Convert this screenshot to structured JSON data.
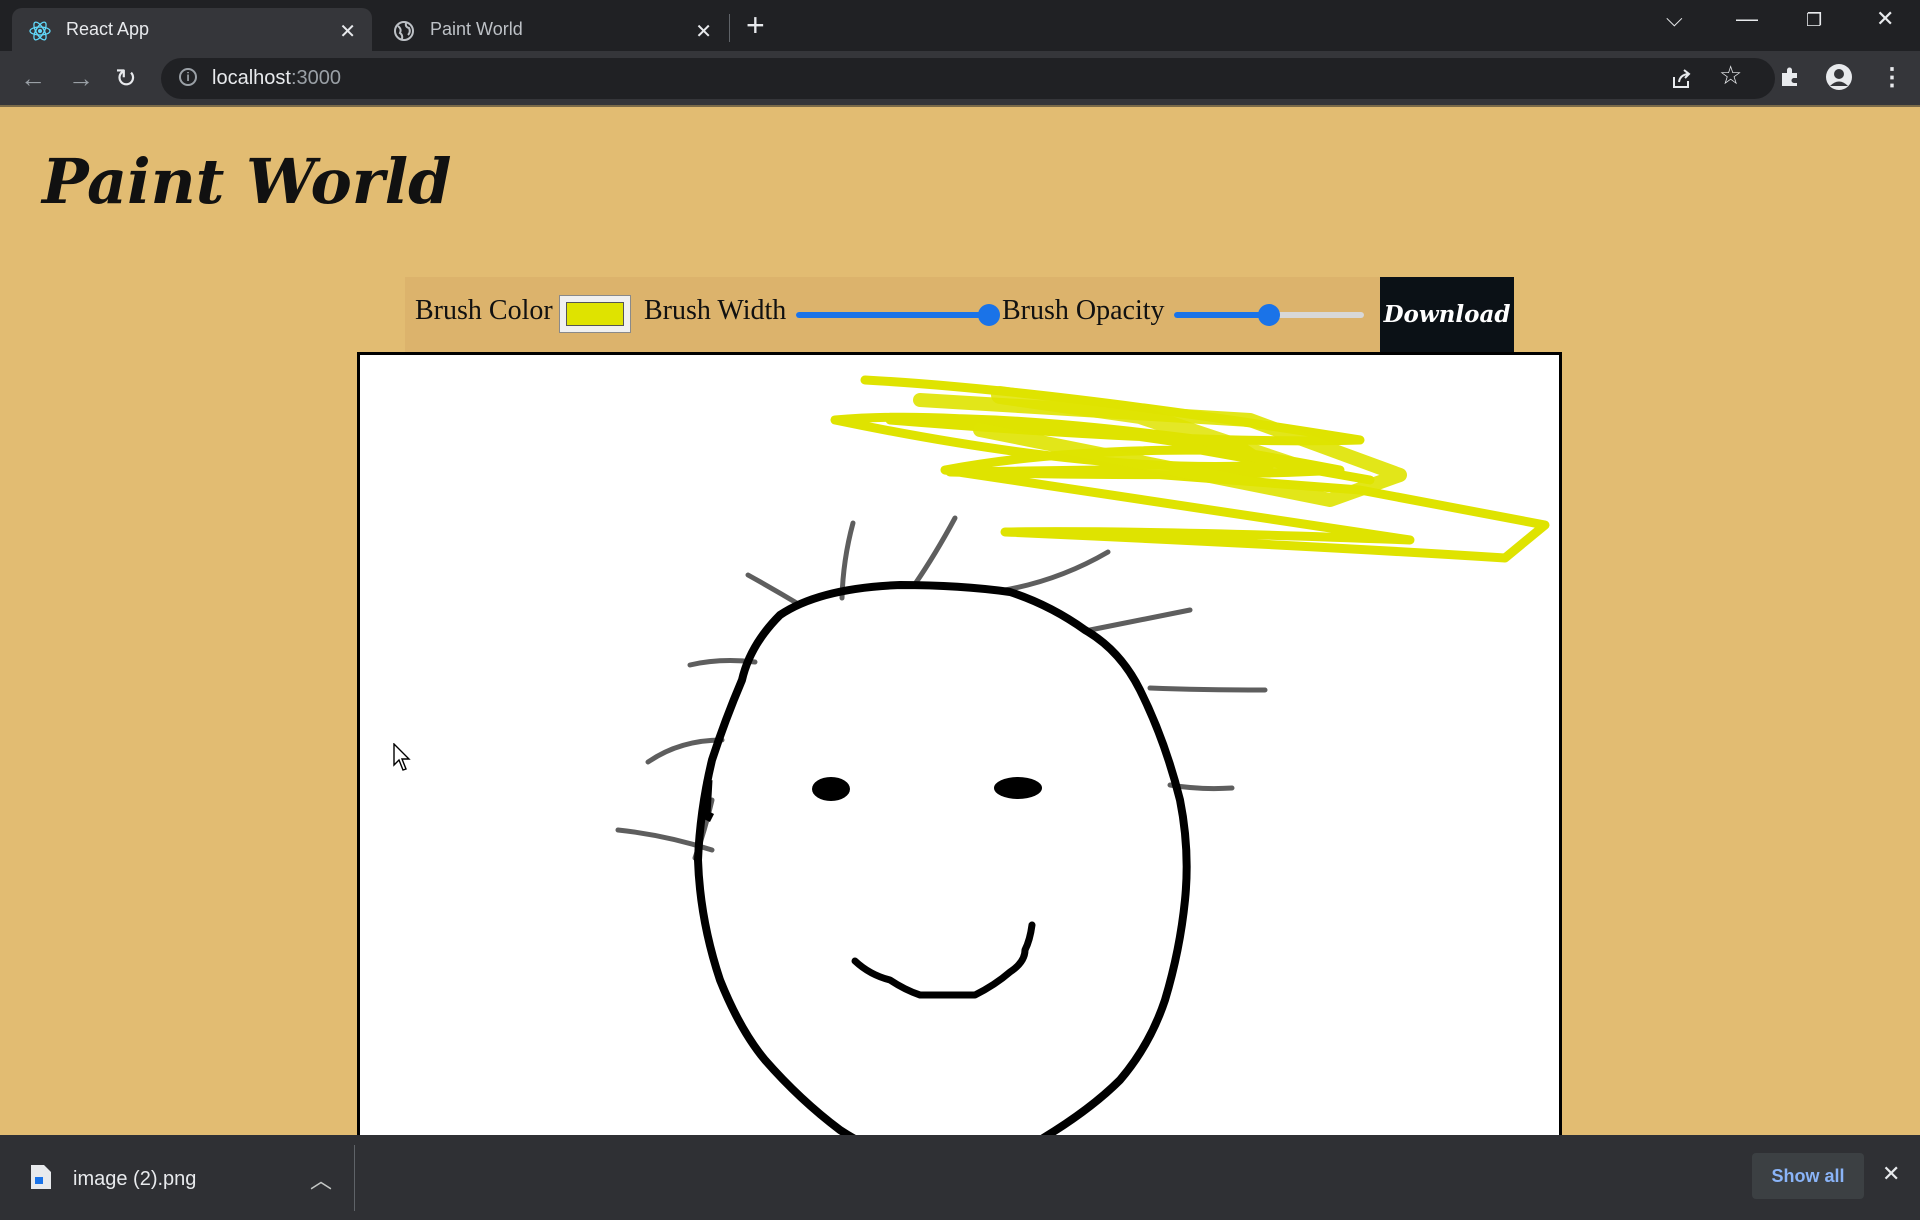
{
  "browser": {
    "tabs": [
      {
        "title": "React App",
        "active": true,
        "favicon": "react-icon"
      },
      {
        "title": "Paint World",
        "active": false,
        "favicon": "globe-icon"
      }
    ],
    "address": {
      "host": "localhost",
      "port": ":3000"
    }
  },
  "app": {
    "title": "Paint World",
    "controls": {
      "brush_color_label": "Brush Color",
      "brush_color": "#dfe300",
      "brush_width_label": "Brush Width",
      "brush_width_value": 1.0,
      "brush_opacity_label": "Brush Opacity",
      "brush_opacity_value": 0.5,
      "download_label": "Download"
    },
    "colors": {
      "page_bg": "#e2bc72",
      "canvas_bg": "#ffffff",
      "accent": "#1a73e8"
    }
  },
  "downloads": {
    "file_name": "image (2).png",
    "show_all_label": "Show all"
  }
}
